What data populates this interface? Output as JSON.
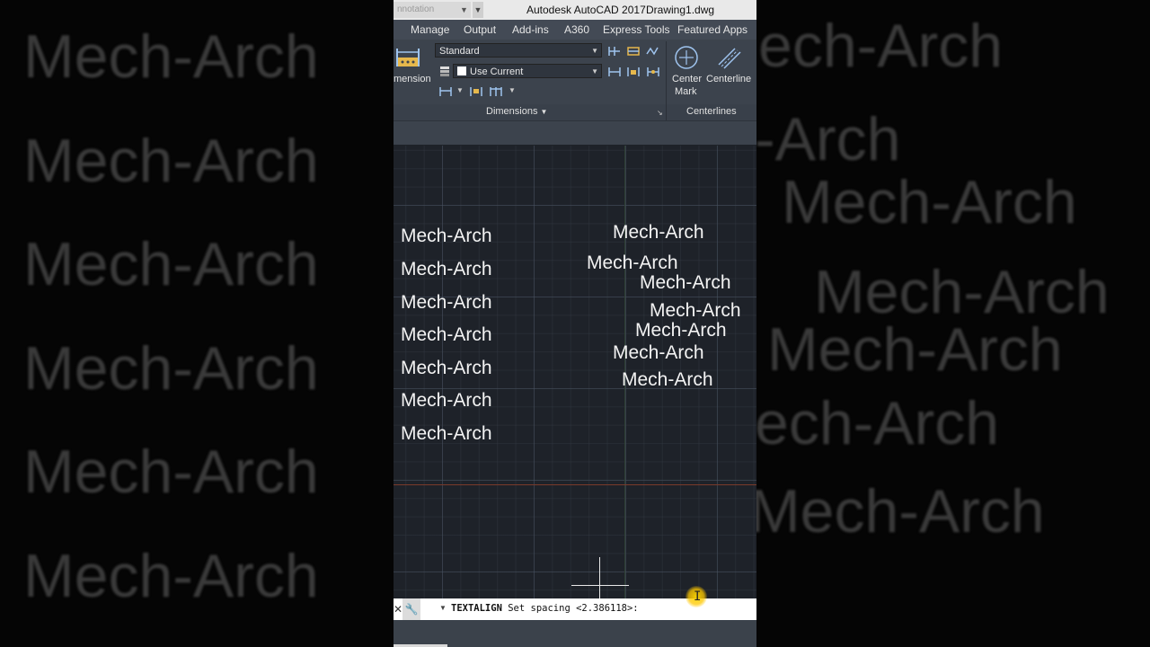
{
  "background": {
    "watermark_text": "Mech-Arch",
    "left_repeats": [
      "Mech-Arch",
      "Mech-Arch",
      "Mech-Arch",
      "Mech-Arch",
      "Mech-Arch",
      "Mech-Arch"
    ],
    "right_fragments": [
      "ech-Arch",
      "-Arch",
      "Mech-Arch",
      "Mech-Arch",
      "Mech-Arch",
      "ech-Arch",
      "Mech-Arch"
    ]
  },
  "titlebar": {
    "workspace_dropdown": "nnotation",
    "app_name": "Autodesk AutoCAD 2017",
    "file_name": "Drawing1.dwg"
  },
  "tabs": [
    "Manage",
    "Output",
    "Add-ins",
    "A360",
    "Express Tools",
    "Featured Apps"
  ],
  "ribbon": {
    "dimension_label": "mension",
    "dim_style": "Standard",
    "layer": "Use Current",
    "dimensions_panel": "Dimensions",
    "center_mark_label_1": "Center",
    "center_mark_label_2": "Mark",
    "centerline_label": "Centerline",
    "centerlines_panel": "Centerlines"
  },
  "viewport": {
    "left_column": [
      "Mech-Arch",
      "Mech-Arch",
      "Mech-Arch",
      "Mech-Arch",
      "Mech-Arch",
      "Mech-Arch",
      "Mech-Arch"
    ],
    "right_cluster": [
      "Mech-Arch",
      "Mech-Arch",
      "Mech-Arch",
      "Mech-Arch",
      "Mech-Arch",
      "Mech-Arch",
      "Mech-Arch"
    ]
  },
  "command_line": {
    "command": "TEXTALIGN",
    "prompt": "Set spacing <2.386118>:"
  },
  "colors": {
    "ribbon": "#3c434d",
    "tabbar": "#434a55",
    "viewport": "#1e2229",
    "x_axis": "#7a3a2a",
    "cursor_highlight": "#ffd700"
  }
}
